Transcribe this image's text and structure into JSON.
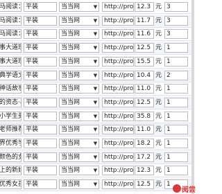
{
  "rows": [
    {
      "title": "马阅读：小",
      "binding": "平装",
      "seller": "当当网",
      "url": "http://product",
      "price": "12.3",
      "currency": "元",
      "quantity": "3"
    },
    {
      "title": "马阅读：小",
      "binding": "平装",
      "seller": "当当网",
      "url": "http://product",
      "price": "11.7",
      "currency": "元",
      "quantity": "3"
    },
    {
      "title": "马阅读：小",
      "binding": "平装",
      "seller": "当当网",
      "url": "http://product",
      "price": "11.6",
      "currency": "元",
      "quantity": "3"
    },
    {
      "title": "事大道理",
      "binding": "平装",
      "seller": "当当网",
      "url": "http://product",
      "price": "12.5",
      "currency": "元",
      "quantity": "1"
    },
    {
      "title": "事大道理彩",
      "binding": "平装",
      "seller": "当当网",
      "url": "http://product",
      "price": "15.5",
      "currency": "元",
      "quantity": "1"
    },
    {
      "title": "典学语文",
      "binding": "平装",
      "seller": "当当网",
      "url": "http://product",
      "price": "10.4",
      "currency": "元",
      "quantity": "2"
    },
    {
      "title": "神话故事",
      "binding": "平装",
      "seller": "当当网",
      "url": "http://product",
      "price": "11.0",
      "currency": "元",
      "quantity": "1"
    },
    {
      "title": "的资态·小",
      "binding": "平装",
      "seller": "当当网",
      "url": "http://product",
      "price": "12.5",
      "currency": "元",
      "quantity": "1"
    },
    {
      "title": "小学生美文",
      "binding": "平装",
      "seller": "当当网",
      "url": "http://product",
      "price": "35.8",
      "currency": "元",
      "quantity": "1"
    },
    {
      "title": "老师推荐的",
      "binding": "平装",
      "seller": "当当网",
      "url": "http://product",
      "price": "11.0",
      "currency": "元",
      "quantity": "1"
    },
    {
      "title": "界优秀学生",
      "binding": "平装",
      "seller": "当当网",
      "url": "http://product",
      "price": "18.2",
      "currency": "元",
      "quantity": "1"
    },
    {
      "title": "颜色的女孩",
      "binding": "平装",
      "seller": "当当网",
      "url": "http://product",
      "price": "17.2",
      "currency": "元",
      "quantity": "1"
    },
    {
      "title": "上的新娘",
      "binding": "平装",
      "seller": "当当网",
      "url": "http://product",
      "price": "12.3",
      "currency": "元",
      "quantity": "1"
    },
    {
      "title": "优秀女孩的",
      "binding": "平装",
      "seller": "当当网",
      "url": "http://product",
      "price": "12.5",
      "currency": "元",
      "quantity": "1"
    }
  ],
  "dropdown_icon": "triangle-down",
  "watermark_text": "阅尝"
}
